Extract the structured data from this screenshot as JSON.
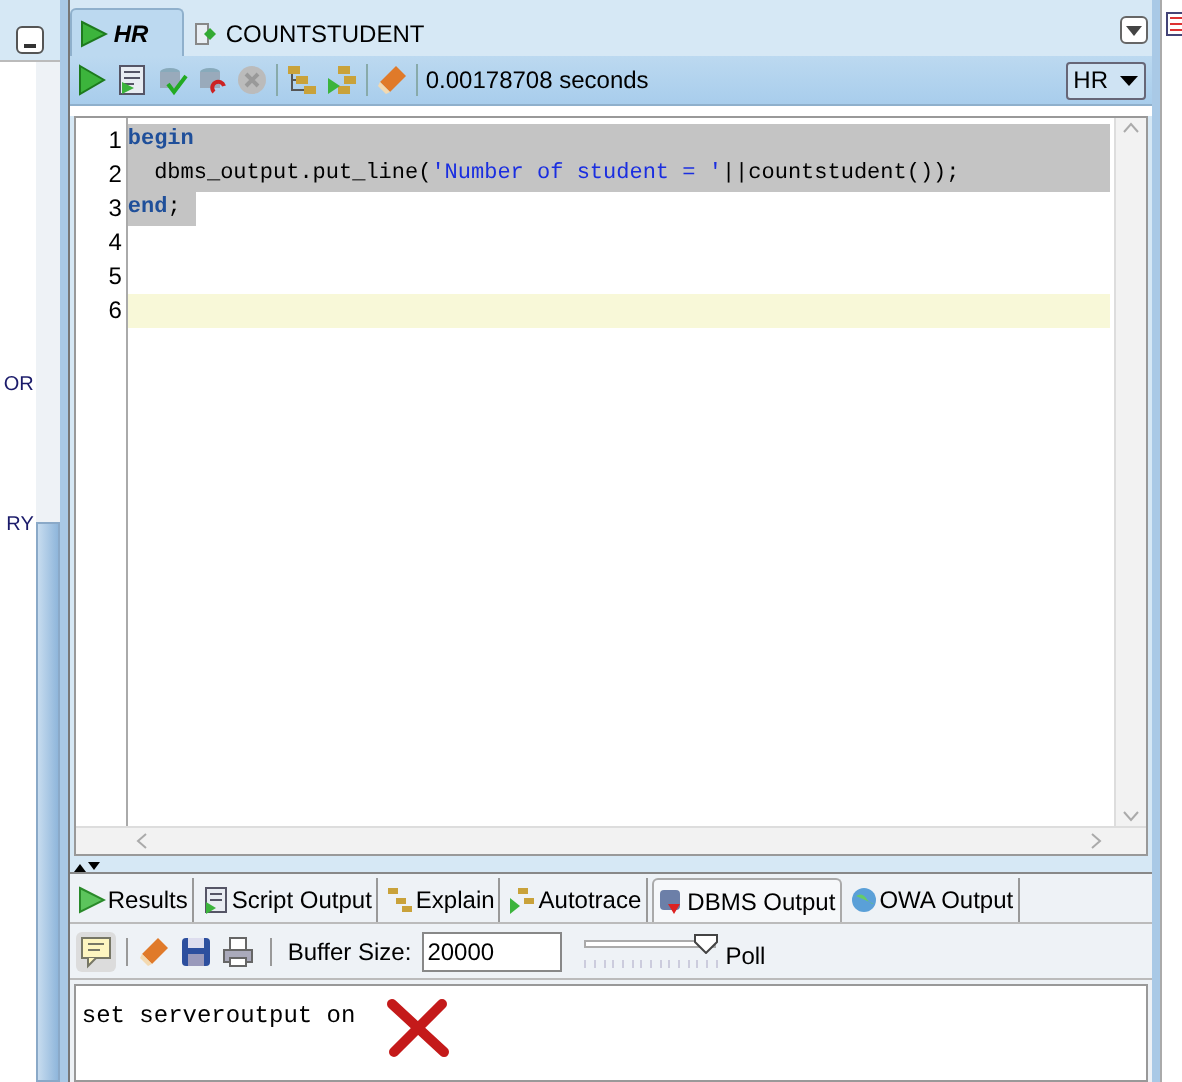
{
  "left_panel": {
    "fragments": [
      "OR",
      "RY"
    ]
  },
  "editor_tabs": [
    {
      "label": "HR",
      "selected": true
    },
    {
      "label": "COUNTSTUDENT",
      "selected": false
    }
  ],
  "toolbar": {
    "elapsed": "0.00178708 seconds",
    "connection": "HR"
  },
  "editor": {
    "lines": [
      {
        "number": "1",
        "selected": true,
        "current": false,
        "tokens": [
          {
            "kind": "keyword",
            "text": "begin"
          }
        ]
      },
      {
        "number": "2",
        "selected": true,
        "current": false,
        "tokens": [
          {
            "kind": "plain",
            "text": "  dbms_output.put_line("
          },
          {
            "kind": "string",
            "text": "'Number of student = '"
          },
          {
            "kind": "plain",
            "text": "||countstudent());"
          }
        ]
      },
      {
        "number": "3",
        "selected": true,
        "current": false,
        "tokens": [
          {
            "kind": "keyword",
            "text": "end"
          },
          {
            "kind": "plain",
            "text": ";"
          }
        ]
      },
      {
        "number": "4",
        "selected": false,
        "current": false
      },
      {
        "number": "5",
        "selected": false,
        "current": false
      },
      {
        "number": "6",
        "selected": false,
        "current": true
      }
    ]
  },
  "output_tabs": [
    {
      "label": "Results",
      "selected": false
    },
    {
      "label": "Script Output",
      "selected": false
    },
    {
      "label": "Explain",
      "selected": false
    },
    {
      "label": "Autotrace",
      "selected": false
    },
    {
      "label": "DBMS Output",
      "selected": true
    },
    {
      "label": "OWA Output",
      "selected": false
    }
  ],
  "dbms_toolbar": {
    "buffer_label": "Buffer Size:",
    "buffer_value": "20000",
    "poll_label": "Poll",
    "level": 0.95
  },
  "output": {
    "text": "set serveroutput on"
  }
}
